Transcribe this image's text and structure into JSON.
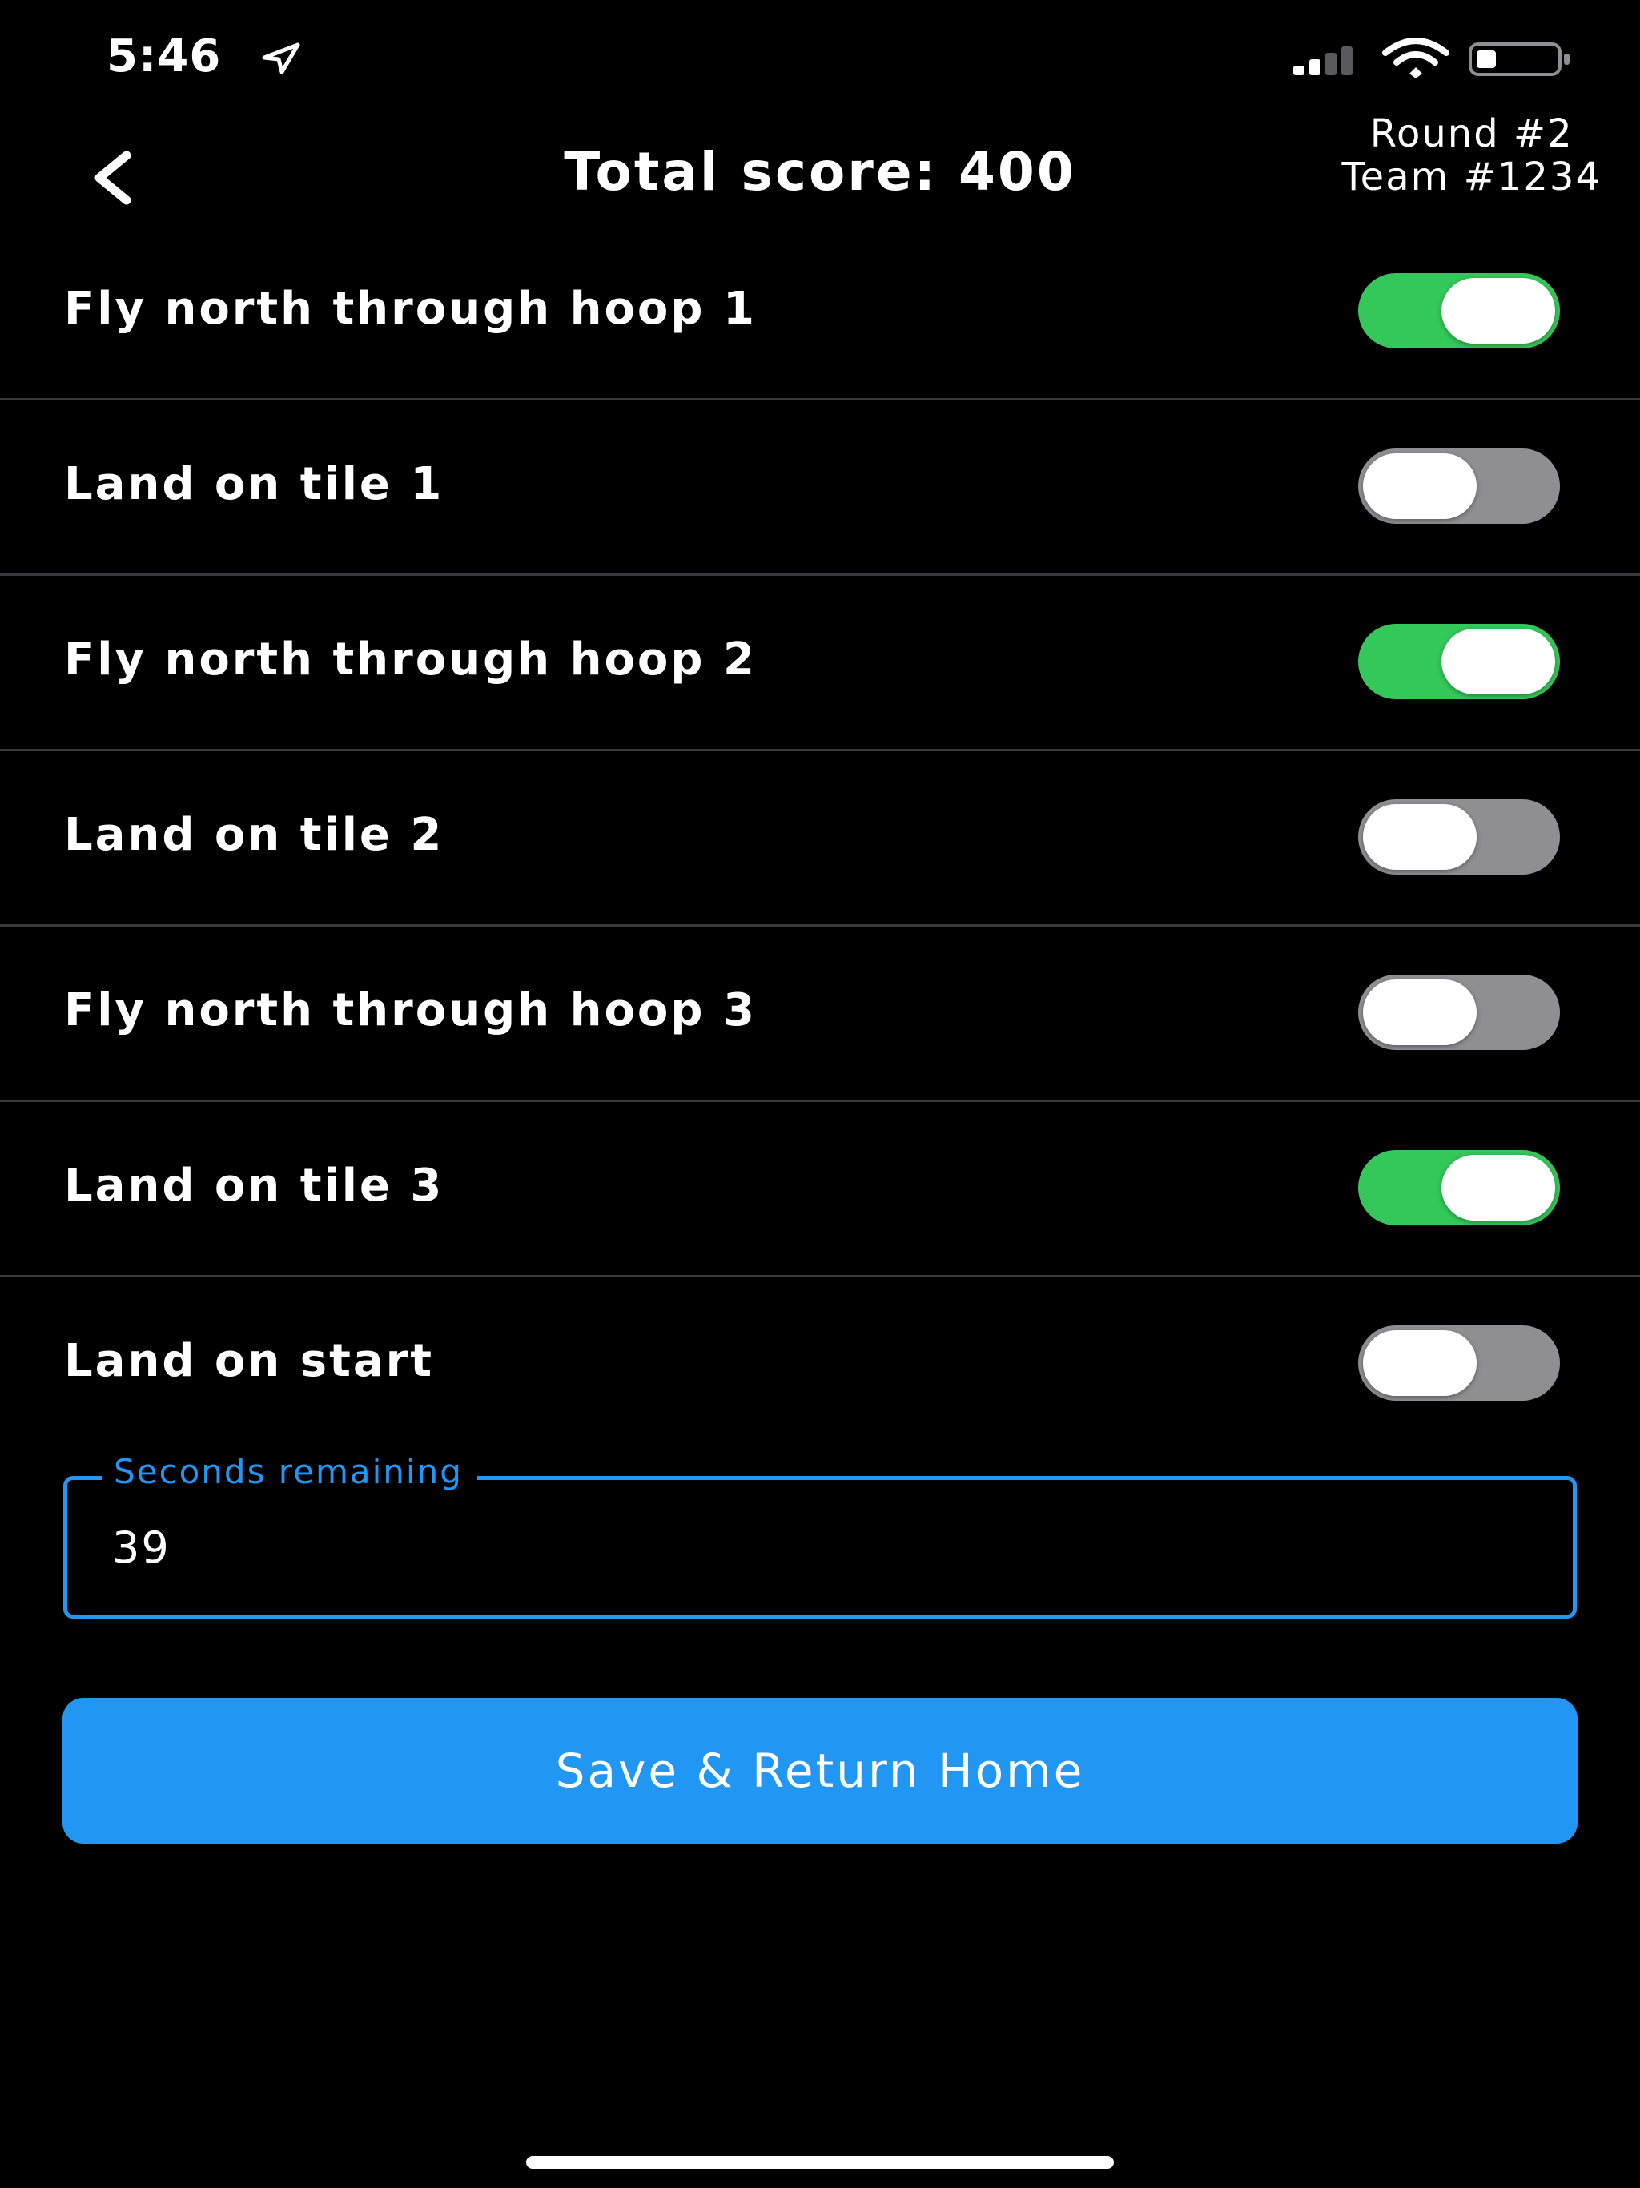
{
  "status_bar": {
    "time": "5:46",
    "icons": [
      "location-arrow-icon",
      "cellular-signal-icon",
      "wifi-icon",
      "battery-icon"
    ]
  },
  "nav": {
    "back_icon": "chevron-left-icon",
    "title": "Total score: 400",
    "round": "Round #2",
    "team": "Team #1234"
  },
  "tasks": [
    {
      "label": "Fly north through hoop 1",
      "on": true
    },
    {
      "label": "Land on tile 1",
      "on": false
    },
    {
      "label": "Fly north through hoop 2",
      "on": true
    },
    {
      "label": "Land on tile 2",
      "on": false
    },
    {
      "label": "Fly north through hoop 3",
      "on": false
    },
    {
      "label": "Land on tile 3",
      "on": true
    },
    {
      "label": "Land on start",
      "on": false
    }
  ],
  "seconds_field": {
    "label": "Seconds remaining",
    "value": "39"
  },
  "save_button": {
    "label": "Save & Return Home"
  },
  "colors": {
    "background": "#000000",
    "toggle_on": "#34c759",
    "toggle_off": "#8e8e93",
    "accent": "#2196f3",
    "divider": "#3a3a3c"
  }
}
